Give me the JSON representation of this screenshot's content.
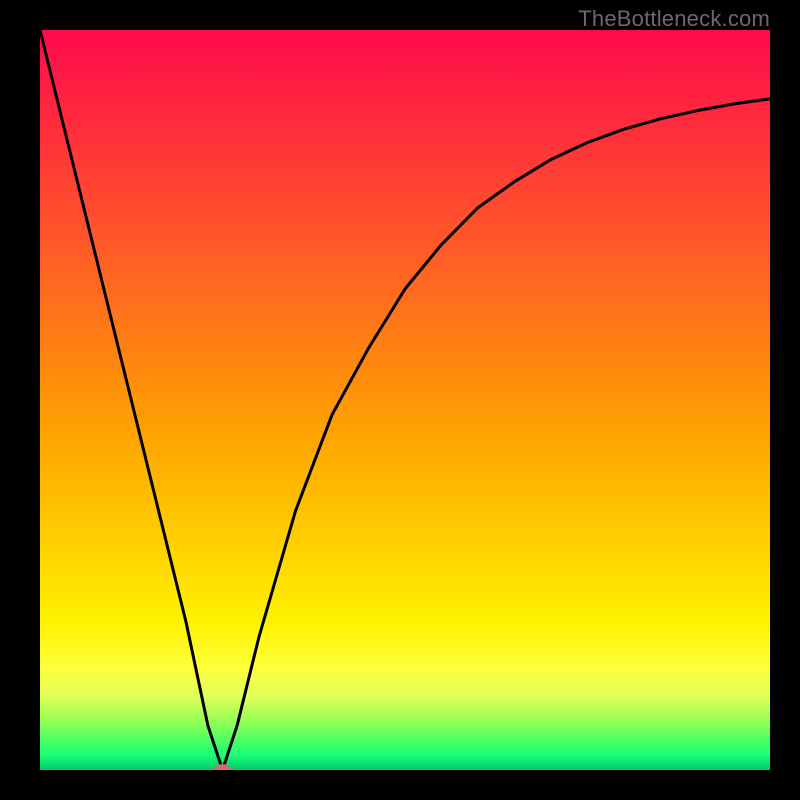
{
  "watermark": "TheBottleneck.com",
  "chart_data": {
    "type": "line",
    "title": "",
    "xlabel": "",
    "ylabel": "",
    "xlim": [
      0,
      100
    ],
    "ylim": [
      0,
      100
    ],
    "grid": false,
    "legend": false,
    "series": [
      {
        "name": "curve",
        "x": [
          0,
          5,
          10,
          15,
          20,
          23,
          25,
          27,
          30,
          35,
          40,
          45,
          50,
          55,
          60,
          65,
          70,
          75,
          80,
          85,
          90,
          95,
          100
        ],
        "y": [
          100,
          80,
          60,
          40,
          20,
          6,
          0,
          6,
          18,
          35,
          48,
          57,
          65,
          71,
          76,
          79.5,
          82.5,
          84.8,
          86.6,
          88,
          89.1,
          90,
          90.7
        ]
      }
    ],
    "marker": {
      "x": 25,
      "y": 0,
      "rx": 1.3,
      "ry": 0.8,
      "color": "#cf6f6f"
    },
    "gradient_stops": [
      {
        "pos": 0,
        "color": "#ff0a4d"
      },
      {
        "pos": 50,
        "color": "#ffa400"
      },
      {
        "pos": 80,
        "color": "#fff200"
      },
      {
        "pos": 100,
        "color": "#00c86a"
      }
    ]
  }
}
